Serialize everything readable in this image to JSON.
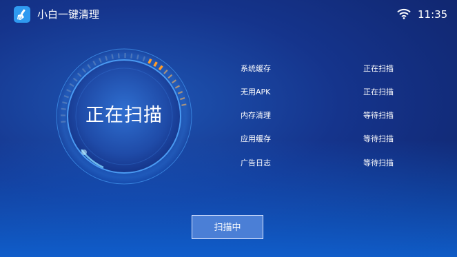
{
  "header": {
    "app_title": "小白一键清理",
    "app_icon": "broom-icon",
    "wifi_icon": "wifi-icon",
    "time": "11:35"
  },
  "scan": {
    "center_text": "正在扫描",
    "button_label": "扫描中"
  },
  "items": [
    {
      "name": "系统缓存",
      "status": "正在扫描"
    },
    {
      "name": "无用APK",
      "status": "正在扫描"
    },
    {
      "name": "内存清理",
      "status": "等待扫描"
    },
    {
      "name": "应用缓存",
      "status": "等待扫描"
    },
    {
      "name": "广告日志",
      "status": "等待扫描"
    }
  ],
  "colors": {
    "accent_orange": "#ff9c2a",
    "button_bg": "#4b7fd6",
    "app_icon_bg": "#2f9af0"
  }
}
